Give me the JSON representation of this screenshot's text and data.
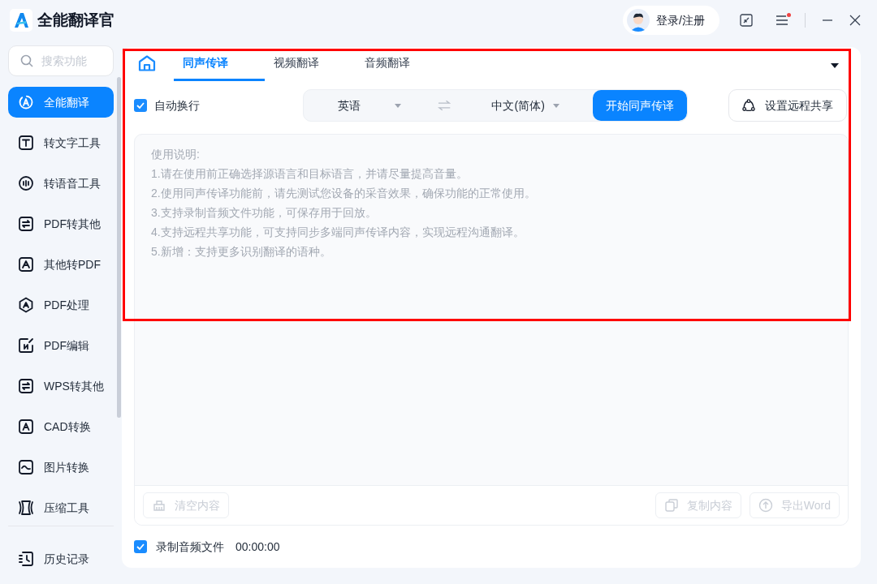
{
  "app": {
    "title": "全能翻译官"
  },
  "header": {
    "login": "登录/注册",
    "notification_dot": true
  },
  "sidebar": {
    "search": {
      "placeholder": "搜索功能"
    },
    "items": [
      {
        "label": "全能翻译",
        "selected": true
      },
      {
        "label": "转文字工具",
        "selected": false
      },
      {
        "label": "转语音工具",
        "selected": false
      },
      {
        "label": "PDF转其他",
        "selected": false
      },
      {
        "label": "其他转PDF",
        "selected": false
      },
      {
        "label": "PDF处理",
        "selected": false
      },
      {
        "label": "PDF编辑",
        "selected": false
      },
      {
        "label": "WPS转其他",
        "selected": false
      },
      {
        "label": "CAD转换",
        "selected": false
      },
      {
        "label": "图片转换",
        "selected": false
      },
      {
        "label": "压缩工具",
        "selected": false
      }
    ],
    "footer_item": {
      "label": "历史记录"
    }
  },
  "tabs": [
    {
      "label": "同声传译",
      "selected": true
    },
    {
      "label": "视频翻译",
      "selected": false
    },
    {
      "label": "音频翻译",
      "selected": false
    }
  ],
  "toolbar": {
    "auto_wrap": {
      "label": "自动换行",
      "checked": true
    },
    "source_language": "英语",
    "target_language": "中文(简体)",
    "start_button": "开始同声传译",
    "share_button": "设置远程共享"
  },
  "instructions": [
    "使用说明:",
    "1.请在使用前正确选择源语言和目标语言，并请尽量提高音量。",
    "2.使用同声传译功能前，请先测试您设备的采音效果，确保功能的正常使用。",
    "3.支持录制音频文件功能，可保存用于回放。",
    "4.支持远程共享功能，可支持同步多端同声传译内容，实现远程沟通翻译。",
    "5.新增：支持更多识别翻译的语种。"
  ],
  "actions": [
    {
      "label": "清空内容",
      "kind": "clear",
      "disabled": true
    },
    {
      "label": "复制内容",
      "kind": "copy",
      "disabled": true
    },
    {
      "label": "导出Word",
      "kind": "export",
      "disabled": true
    }
  ],
  "recording": {
    "label": "录制音频文件",
    "checked": true,
    "time": "00:00:00"
  }
}
